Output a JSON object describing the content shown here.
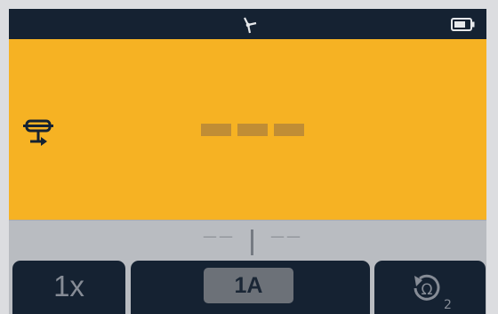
{
  "colors": {
    "status_bar": "#152232",
    "main_panel": "#f6b223",
    "sub_panel": "#b9bcc1",
    "softkey_bg": "#152232",
    "selected_softkey": "#6c7178"
  },
  "status_bar": {
    "center_icon": "signal-icon",
    "battery_icon": "battery-icon"
  },
  "main": {
    "mode_icon": "mode-icon",
    "readout_state": "no-reading"
  },
  "sub_readout": {
    "left": "——",
    "right": "——"
  },
  "softkeys": [
    {
      "label": "1x"
    },
    {
      "label": "1A"
    },
    {
      "label": "2",
      "icon": "zero-icon"
    }
  ]
}
